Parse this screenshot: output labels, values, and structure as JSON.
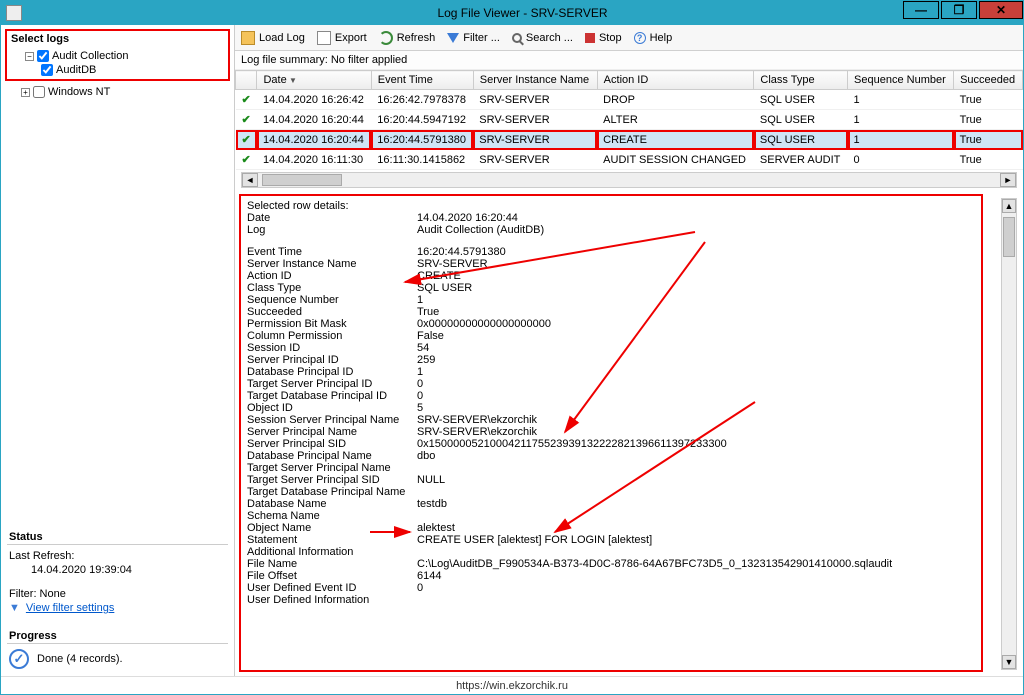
{
  "window": {
    "title": "Log File Viewer - SRV-SERVER"
  },
  "toolbar": {
    "load": "Load Log",
    "export": "Export",
    "refresh": "Refresh",
    "filter": "Filter ...",
    "search": "Search ...",
    "stop": "Stop",
    "help": "Help"
  },
  "sidebar": {
    "select_logs": "Select logs",
    "audit_collection": "Audit Collection",
    "auditdb": "AuditDB",
    "windows_nt": "Windows NT",
    "status_head": "Status",
    "last_refresh_label": "Last Refresh:",
    "last_refresh_value": "14.04.2020 19:39:04",
    "filter_label": "Filter: None",
    "filter_link": "View filter settings",
    "progress_head": "Progress",
    "progress_text": "Done (4 records)."
  },
  "summary": "Log file summary: No filter applied",
  "columns": [
    "",
    "Date",
    "Event Time",
    "Server Instance Name",
    "Action ID",
    "Class Type",
    "Sequence Number",
    "Succeeded"
  ],
  "rows": [
    {
      "date": "14.04.2020 16:26:42",
      "event": "16:26:42.7978378",
      "server": "SRV-SERVER",
      "action": "DROP",
      "class": "SQL USER",
      "seq": "1",
      "succ": "True",
      "selected": false
    },
    {
      "date": "14.04.2020 16:20:44",
      "event": "16:20:44.5947192",
      "server": "SRV-SERVER",
      "action": "ALTER",
      "class": "SQL USER",
      "seq": "1",
      "succ": "True",
      "selected": false
    },
    {
      "date": "14.04.2020 16:20:44",
      "event": "16:20:44.5791380",
      "server": "SRV-SERVER",
      "action": "CREATE",
      "class": "SQL USER",
      "seq": "1",
      "succ": "True",
      "selected": true
    },
    {
      "date": "14.04.2020 16:11:30",
      "event": "16:11:30.1415862",
      "server": "SRV-SERVER",
      "action": "AUDIT SESSION CHANGED",
      "class": "SERVER AUDIT",
      "seq": "0",
      "succ": "True",
      "selected": false
    }
  ],
  "details": {
    "head": "Selected row details:",
    "items": [
      [
        "Date",
        "14.04.2020 16:20:44"
      ],
      [
        "Log",
        "Audit Collection (AuditDB)"
      ],
      [
        "",
        ""
      ],
      [
        "Event Time",
        "16:20:44.5791380"
      ],
      [
        "Server Instance Name",
        "SRV-SERVER"
      ],
      [
        "Action ID",
        "CREATE"
      ],
      [
        "Class Type",
        "SQL USER"
      ],
      [
        "Sequence Number",
        "1"
      ],
      [
        "Succeeded",
        "True"
      ],
      [
        "Permission Bit Mask",
        "0x00000000000000000000"
      ],
      [
        "Column Permission",
        "False"
      ],
      [
        "Session ID",
        "54"
      ],
      [
        "Server Principal ID",
        "259"
      ],
      [
        "Database Principal ID",
        "1"
      ],
      [
        "Target Server Principal ID",
        "0"
      ],
      [
        "Target Database Principal ID",
        "0"
      ],
      [
        "Object ID",
        "5"
      ],
      [
        "Session Server Principal Name",
        "SRV-SERVER\\ekzorchik"
      ],
      [
        "Server Principal Name",
        "SRV-SERVER\\ekzorchik"
      ],
      [
        "Server Principal SID",
        "0x1500000521000421175523939132222821396611397233300"
      ],
      [
        "Database Principal Name",
        "dbo"
      ],
      [
        "Target Server Principal Name",
        ""
      ],
      [
        "Target Server Principal SID",
        "NULL"
      ],
      [
        "Target Database Principal Name",
        ""
      ],
      [
        "Database Name",
        "testdb"
      ],
      [
        "Schema Name",
        ""
      ],
      [
        "Object Name",
        "alektest"
      ],
      [
        "Statement",
        "CREATE USER [alektest] FOR LOGIN [alektest]"
      ],
      [
        "Additional Information",
        ""
      ],
      [
        "File Name",
        "C:\\Log\\AuditDB_F990534A-B373-4D0C-8786-64A67BFC73D5_0_132313542901410000.sqlaudit"
      ],
      [
        "File Offset",
        "6144"
      ],
      [
        "User Defined Event ID",
        "0"
      ],
      [
        "User Defined Information",
        ""
      ]
    ]
  },
  "footer": "https://win.ekzorchik.ru"
}
